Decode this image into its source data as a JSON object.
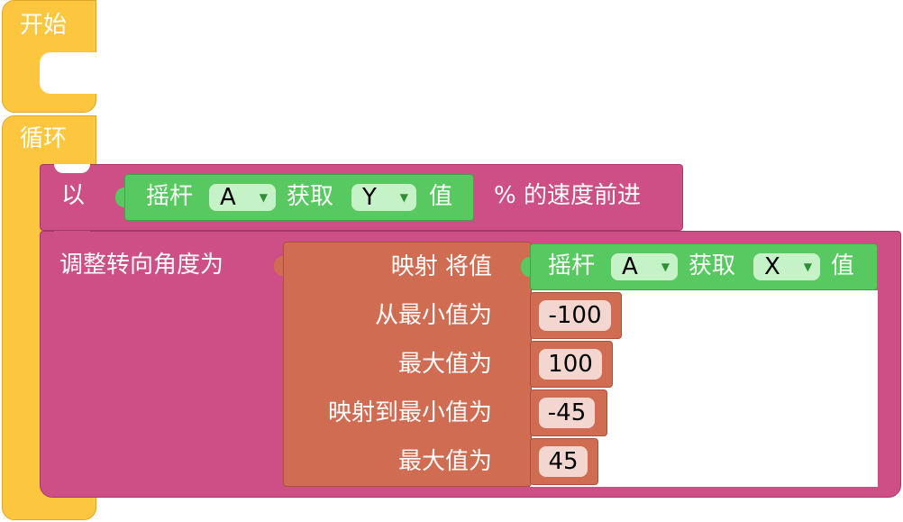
{
  "start_block": {
    "label": "开始"
  },
  "loop_block": {
    "label": "循环"
  },
  "move_block": {
    "prefix": "以",
    "suffix": "% 的速度前进",
    "joystick": {
      "label": "摇杆",
      "stick": "A",
      "get_label": "获取",
      "axis": "Y",
      "value_label": "值"
    }
  },
  "steer_block": {
    "label": "调整转向角度为",
    "map_block": {
      "title": "映射  将值",
      "joystick": {
        "label": "摇杆",
        "stick": "A",
        "get_label": "获取",
        "axis": "X",
        "value_label": "值"
      },
      "from_min_label": "从最小值为",
      "from_min_value": "-100",
      "from_max_label": "最大值为",
      "from_max_value": "100",
      "to_min_label": "映射到最小值为",
      "to_min_value": "-45",
      "to_max_label": "最大值为",
      "to_max_value": "45"
    }
  },
  "colors": {
    "event": "#fcc63f",
    "motion": "#cd4f86",
    "operator": "#cf6c52",
    "sensor": "#58c860"
  }
}
